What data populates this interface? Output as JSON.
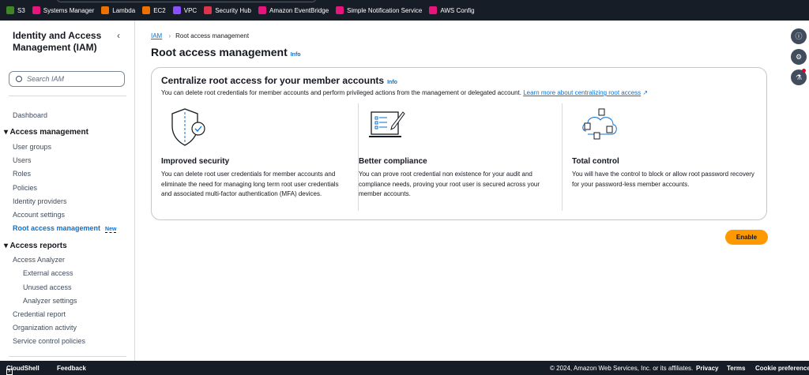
{
  "favorites": [
    {
      "label": "S3",
      "color": "#3f8624"
    },
    {
      "label": "Systems Manager",
      "color": "#e7157b"
    },
    {
      "label": "Lambda",
      "color": "#ed7100"
    },
    {
      "label": "EC2",
      "color": "#ed7100"
    },
    {
      "label": "VPC",
      "color": "#8c4fff"
    },
    {
      "label": "Security Hub",
      "color": "#dd344c"
    },
    {
      "label": "Amazon EventBridge",
      "color": "#e7157b"
    },
    {
      "label": "Simple Notification Service",
      "color": "#e7157b"
    },
    {
      "label": "AWS Config",
      "color": "#e7157b"
    }
  ],
  "sidebar": {
    "title": "Identity and Access Management (IAM)",
    "collapse": "‹",
    "search_placeholder": "Search IAM",
    "dashboard": "Dashboard",
    "access_management": "Access management",
    "am_items": [
      "User groups",
      "Users",
      "Roles",
      "Policies",
      "Identity providers",
      "Account settings"
    ],
    "root_access": "Root access management",
    "new_badge": "New",
    "access_reports": "Access reports",
    "analyzer": "Access Analyzer",
    "analyzer_items": [
      "External access",
      "Unused access",
      "Analyzer settings"
    ],
    "ar_items": [
      "Credential report",
      "Organization activity",
      "Service control policies"
    ]
  },
  "breadcrumb": {
    "root": "IAM",
    "current": "Root access management",
    "sep": "›"
  },
  "page": {
    "title": "Root access management",
    "info": "Info"
  },
  "card": {
    "title": "Centralize root access for your member accounts",
    "info": "Info",
    "desc": "You can delete root credentials for member accounts and perform privileged actions from the management or delegated account.",
    "link": "Learn more about centralizing root access",
    "columns": [
      {
        "title": "Improved security",
        "text": "You can delete root user credentials for member accounts and eliminate the need for managing long term root user credentials and associated multi-factor authentication (MFA) devices."
      },
      {
        "title": "Better compliance",
        "text": "You can prove root credential non existence for your audit and compliance needs, proving your root user is secured across your member accounts."
      },
      {
        "title": "Total control",
        "text": "You will have the control to block or allow root password recovery for your password-less member accounts."
      }
    ]
  },
  "enable_label": "Enable",
  "footer": {
    "cloudshell": "CloudShell",
    "feedback": "Feedback",
    "copyright": "© 2024, Amazon Web Services, Inc. or its affiliates.",
    "privacy": "Privacy",
    "terms": "Terms",
    "cookies": "Cookie preferences"
  }
}
